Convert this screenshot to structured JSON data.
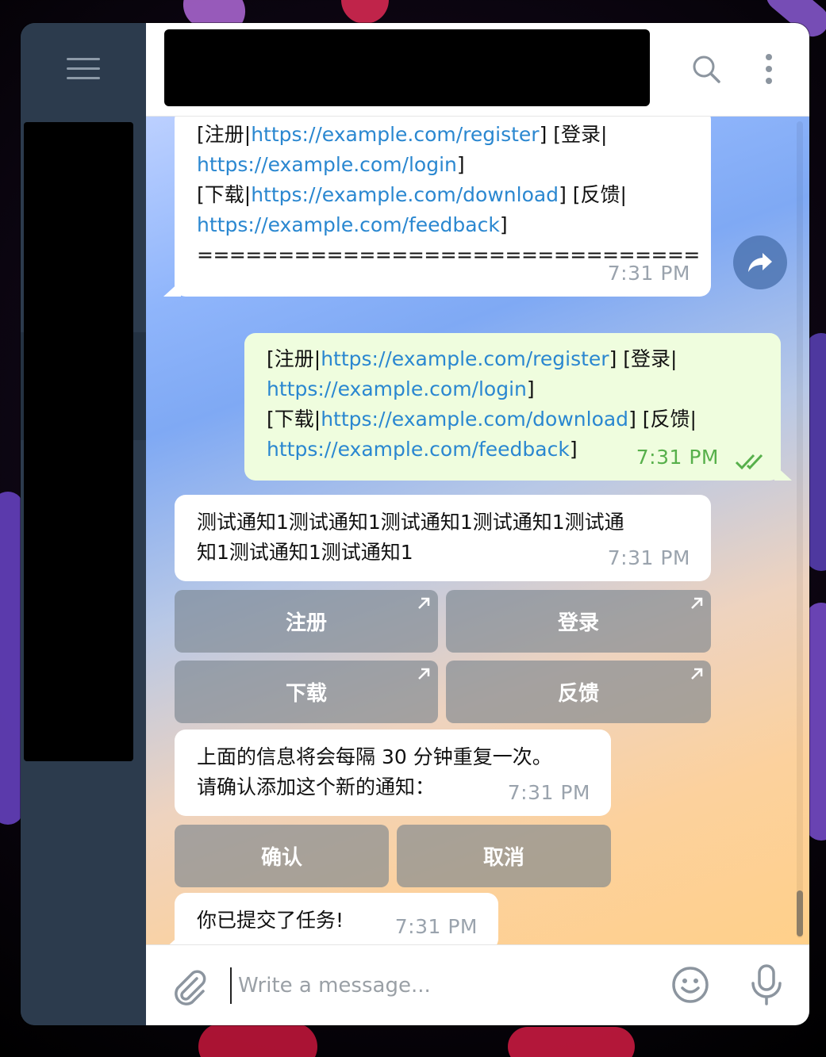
{
  "window": {
    "sidebar": {
      "menu_icon": "hamburger-menu-icon"
    },
    "header": {
      "title": "",
      "search_icon": "search-icon",
      "more_icon": "more-vertical-icon"
    }
  },
  "messages": [
    {
      "direction": "in",
      "segments": [
        {
          "t": "[注册|",
          "link": false
        },
        {
          "t": "https://example.com/register",
          "link": true
        },
        {
          "t": "] [登录|",
          "link": false
        }
      ],
      "line2": [
        {
          "t": "https://example.com/login",
          "link": true
        },
        {
          "t": "]",
          "link": false
        }
      ],
      "line3": [
        {
          "t": "[下载|",
          "link": false
        },
        {
          "t": "https://example.com/download",
          "link": true
        },
        {
          "t": "] [反馈|",
          "link": false
        }
      ],
      "line4": [
        {
          "t": "https://example.com/feedback",
          "link": true
        },
        {
          "t": "]",
          "link": false
        }
      ],
      "line5": "===============================",
      "time": "7:31 PM"
    },
    {
      "direction": "out",
      "line1": [
        {
          "t": "[注册|",
          "link": false
        },
        {
          "t": "https://example.com/register",
          "link": true
        },
        {
          "t": "] [登录|",
          "link": false
        }
      ],
      "line2": [
        {
          "t": "https://example.com/login",
          "link": true
        },
        {
          "t": "]",
          "link": false
        }
      ],
      "line3": [
        {
          "t": "[下载|",
          "link": false
        },
        {
          "t": "https://example.com/download",
          "link": true
        },
        {
          "t": "] [反馈|",
          "link": false
        }
      ],
      "line4": [
        {
          "t": "https://example.com/feedback",
          "link": true
        },
        {
          "t": "]",
          "link": false
        }
      ],
      "time": "7:31 PM",
      "status_icon": "double-check-read-icon"
    },
    {
      "direction": "in",
      "line1": "测试通知1测试通知1测试通知1测试通知1测试通",
      "line2": "知1测试通知1测试通知1",
      "time": "7:31 PM",
      "buttons": [
        "注册",
        "登录",
        "下载",
        "反馈"
      ],
      "button_icon": "external-link-arrow-icon"
    },
    {
      "direction": "in",
      "line1": "上面的信息将会每隔 30 分钟重复一次。",
      "line2": "请确认添加这个新的通知：",
      "time": "7:31 PM",
      "buttons": [
        "确认",
        "取消"
      ]
    },
    {
      "direction": "in",
      "line1": "你已提交了任务!",
      "time": "7:31 PM"
    }
  ],
  "forward_icon": "forward-share-icon",
  "composer": {
    "placeholder": "Write a message...",
    "attach_icon": "paperclip-icon",
    "emoji_icon": "emoji-smile-icon",
    "mic_icon": "microphone-icon"
  },
  "colors": {
    "sidebar": "#2c3b4d",
    "link": "#2a87d0",
    "outgoing_bubble": "#effdde",
    "read_check": "#57b04b"
  }
}
